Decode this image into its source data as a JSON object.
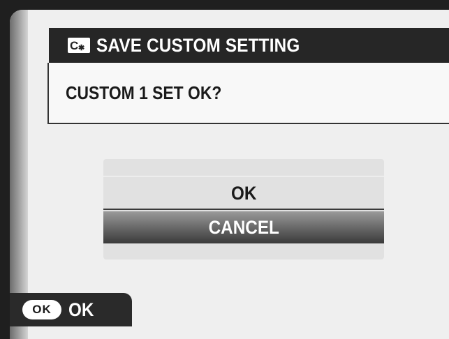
{
  "dialog": {
    "title": "SAVE CUSTOM SETTING",
    "title_icon": "custom-setting-icon",
    "message": "CUSTOM 1 SET OK?"
  },
  "menu": {
    "items": [
      {
        "label": "OK",
        "selected": false
      },
      {
        "label": "CANCEL",
        "selected": true
      }
    ]
  },
  "hint": {
    "button_icon_text": "OK",
    "label": "OK"
  },
  "colors": {
    "title_bar": "#262626",
    "screen_bg": "#efefef",
    "selected_item_dark": "#3a3a3a"
  }
}
